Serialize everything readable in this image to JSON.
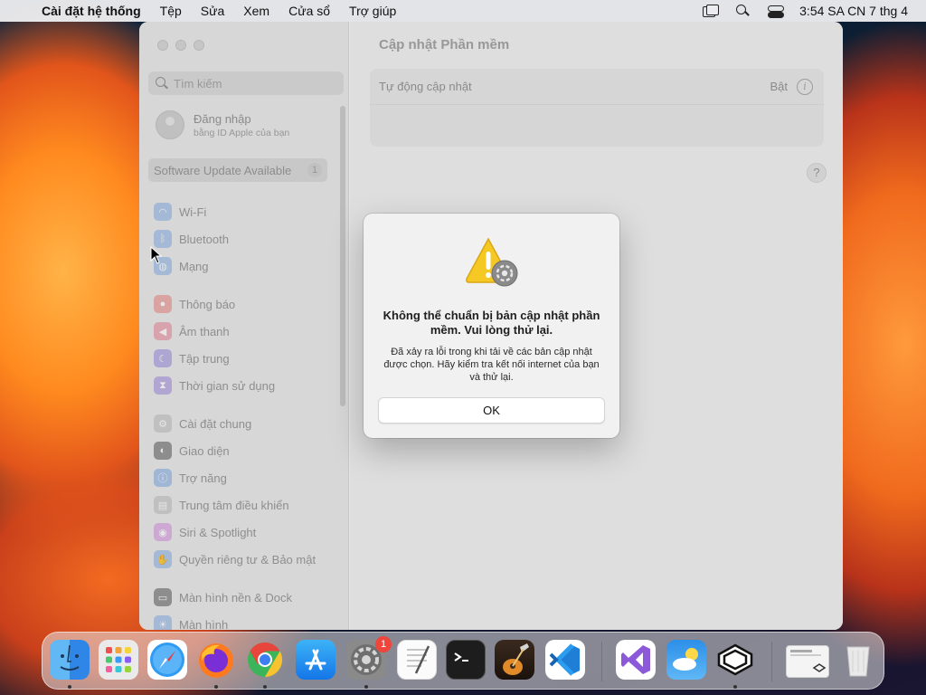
{
  "menubar": {
    "app_name": "Cài đặt hệ thống",
    "menus": [
      "Tệp",
      "Sửa",
      "Xem",
      "Cửa sổ",
      "Trợ giúp"
    ],
    "clock": "3:54 SA CN 7 thg 4"
  },
  "sidebar": {
    "search_placeholder": "Tìm kiếm",
    "account_title": "Đăng nhập",
    "account_subtitle": "bằng ID Apple của bạn",
    "update_label": "Software Update Available",
    "update_count": "1",
    "items": [
      {
        "label": "Wi-Fi",
        "icon": "wifi-icon",
        "color": "#3b8cf0"
      },
      {
        "label": "Bluetooth",
        "icon": "bluetooth-icon",
        "color": "#3b8cf0"
      },
      {
        "label": "Mạng",
        "icon": "network-icon",
        "color": "#3b8cf0"
      },
      {
        "label": "Thông báo",
        "icon": "notifications-icon",
        "color": "#ee4a45"
      },
      {
        "label": "Âm thanh",
        "icon": "sound-icon",
        "color": "#ee4a6a"
      },
      {
        "label": "Tập trung",
        "icon": "focus-icon",
        "color": "#6a5ad8"
      },
      {
        "label": "Thời gian sử dụng",
        "icon": "screen-time-icon",
        "color": "#7b5ad6"
      },
      {
        "label": "Cài đặt chung",
        "icon": "general-icon",
        "color": "#9a9a9a"
      },
      {
        "label": "Giao diện",
        "icon": "appearance-icon",
        "color": "#2a2a2a"
      },
      {
        "label": "Trợ năng",
        "icon": "accessibility-icon",
        "color": "#2f7de0"
      },
      {
        "label": "Trung tâm điều khiển",
        "icon": "control-center-icon",
        "color": "#9a9a9a"
      },
      {
        "label": "Siri & Spotlight",
        "icon": "siri-icon",
        "color": "#c04fd0"
      },
      {
        "label": "Quyền riêng tư & Bảo mật",
        "icon": "privacy-icon",
        "color": "#3b8cf0"
      },
      {
        "label": "Màn hình nền & Dock",
        "icon": "desktop-dock-icon",
        "color": "#2a2a2a"
      },
      {
        "label": "Màn hình",
        "icon": "displays-icon",
        "color": "#3b8cf0"
      }
    ]
  },
  "content": {
    "title": "Cập nhật Phần mềm",
    "auto_update_label": "Tự động cập nhật",
    "auto_update_value": "Bật",
    "help_label": "?"
  },
  "alert": {
    "title": "Không thể chuẩn bị bản cập nhật phần mềm. Vui lòng thử lại.",
    "message": "Đã xảy ra lỗi trong khi tải về các bản cập nhật được chọn. Hãy kiểm tra kết nối internet của bạn và thử lại.",
    "ok_label": "OK"
  },
  "dock": {
    "settings_badge": "1",
    "apps": [
      "finder-icon",
      "launchpad-icon",
      "safari-icon",
      "firefox-icon",
      "chrome-icon",
      "app-store-icon",
      "system-settings-icon",
      "textedit-icon",
      "terminal-icon",
      "garageband-icon",
      "vscode-icon",
      "visual-studio-icon",
      "weather-icon",
      "unity-icon",
      "downloads-stack-icon",
      "trash-icon"
    ]
  }
}
